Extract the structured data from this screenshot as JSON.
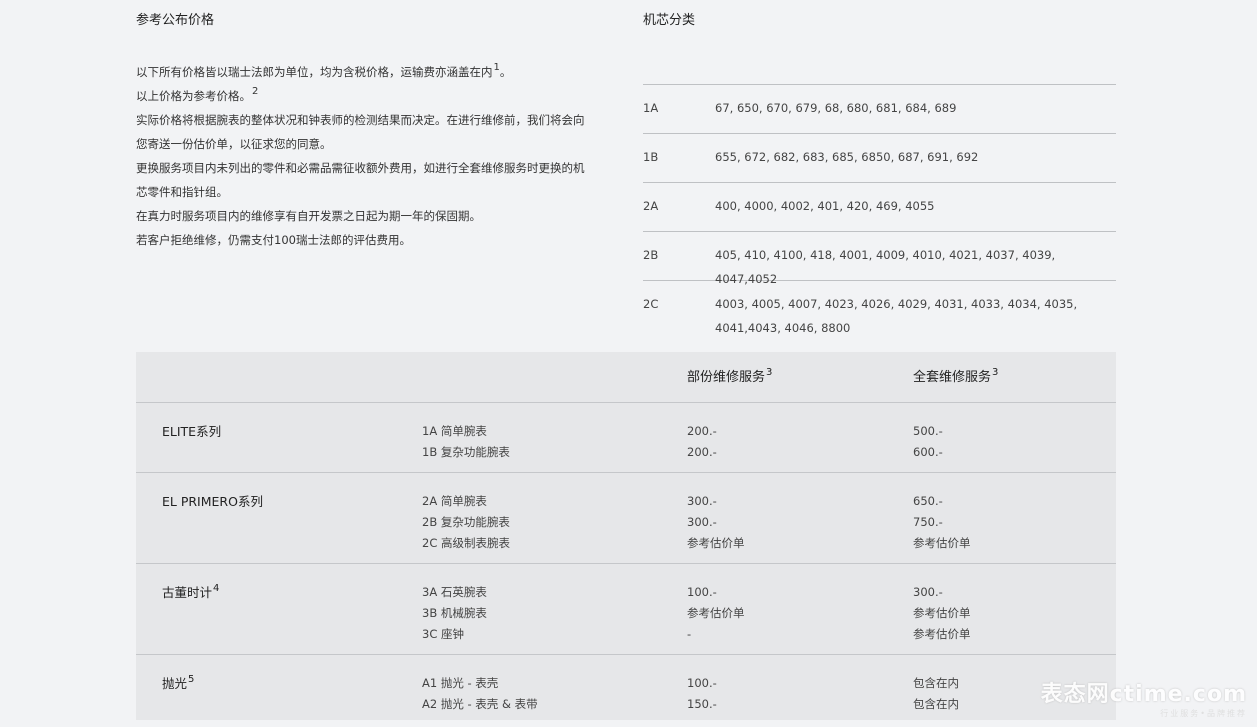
{
  "left": {
    "title": "参考公布价格",
    "lines": [
      {
        "text": "以下所有价格皆以瑞士法郎为单位，均为含税价格，运输费亦涵盖在内",
        "sup": "1",
        "tail": "。"
      },
      {
        "text": "以上价格为参考价格。",
        "sup": "2",
        "tail": ""
      },
      {
        "text": "实际价格将根据腕表的整体状况和钟表师的检测结果而决定。在进行维修前，我们将会向",
        "sup": "",
        "tail": ""
      },
      {
        "text": "您寄送一份估价单，以征求您的同意。",
        "sup": "",
        "tail": ""
      },
      {
        "text": "更换服务项目内未列出的零件和必需品需征收额外费用，如进行全套维修服务时更换的机",
        "sup": "",
        "tail": ""
      },
      {
        "text": "芯零件和指针组。",
        "sup": "",
        "tail": ""
      },
      {
        "text": "在真力时服务项目内的维修享有自开发票之日起为期一年的保固期。",
        "sup": "",
        "tail": ""
      },
      {
        "text": "若客户拒绝维修，仍需支付100瑞士法郎的评估费用。",
        "sup": "",
        "tail": ""
      }
    ]
  },
  "right": {
    "title": "机芯分类",
    "rows": [
      {
        "code": "1A",
        "values": "67, 650, 670, 679, 68, 680, 681, 684, 689"
      },
      {
        "code": "1B",
        "values": "655, 672, 682, 683, 685, 6850, 687, 691, 692"
      },
      {
        "code": "2A",
        "values": "400, 4000, 4002, 401, 420, 469, 4055"
      },
      {
        "code": "2B",
        "values": "405, 410, 4100, 418, 4001, 4009, 4010, 4021, 4037, 4039, 4047,4052"
      },
      {
        "code": "2C",
        "values": "4003, 4005, 4007, 4023, 4026, 4029, 4031, 4033, 4034, 4035, 4041,4043, 4046, 8800"
      }
    ]
  },
  "price": {
    "head_partial": "部份维修服务",
    "head_partial_sup": "3",
    "head_full": "全套维修服务",
    "head_full_sup": "3",
    "rows": [
      {
        "name": "ELITE系列",
        "sup": "",
        "items": [
          "1A 简单腕表",
          "1B 复杂功能腕表"
        ],
        "partial": [
          "200.-",
          "200.-"
        ],
        "full": [
          "500.-",
          "600.-"
        ]
      },
      {
        "name": "EL PRIMERO系列",
        "sup": "",
        "items": [
          "2A 简单腕表",
          "2B 复杂功能腕表",
          "2C 高级制表腕表"
        ],
        "partial": [
          "300.-",
          "300.-",
          "参考估价单"
        ],
        "full": [
          "650.-",
          "750.-",
          "参考估价单"
        ]
      },
      {
        "name": "古董时计",
        "sup": "4",
        "items": [
          "3A 石英腕表",
          "3B 机械腕表",
          "3C 座钟"
        ],
        "partial": [
          "100.-",
          "参考估价单",
          "-"
        ],
        "full": [
          "300.-",
          "参考估价单",
          "参考估价单"
        ]
      },
      {
        "name": "抛光",
        "sup": "5",
        "items": [
          "A1 抛光 - 表壳",
          "A2 抛光 - 表壳 & 表带"
        ],
        "partial": [
          "100.-",
          "150.-"
        ],
        "full": [
          "包含在内",
          "包含在内"
        ]
      }
    ]
  },
  "watermark": {
    "main": "表态网ctime.com",
    "sub": "行业服务•品牌推荐"
  }
}
